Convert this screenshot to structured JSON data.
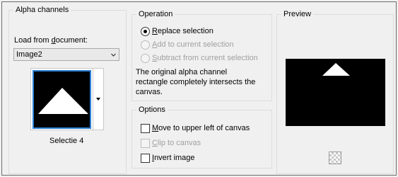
{
  "alpha": {
    "title": "Alpha channels",
    "load_label": "Load from document:",
    "load_label_pre": "Load from ",
    "load_label_u": "d",
    "load_label_post": "ocument:",
    "document_value": "Image2",
    "selection_name": "Selectie 4"
  },
  "operation": {
    "title": "Operation",
    "options": [
      {
        "pre": "",
        "u": "R",
        "post": "eplace selection",
        "checked": true,
        "enabled": true
      },
      {
        "pre": "",
        "u": "A",
        "post": "dd to current selection",
        "checked": false,
        "enabled": false
      },
      {
        "pre": "",
        "u": "S",
        "post": "ubtract from current selection",
        "checked": false,
        "enabled": false
      }
    ],
    "message_line1": "The original alpha channel",
    "message_line2": "rectangle completely intersects the",
    "message_line3": "canvas."
  },
  "options": {
    "title": "Options",
    "items": [
      {
        "pre": "",
        "u": "M",
        "post": "ove to upper left of canvas",
        "checked": false,
        "enabled": true
      },
      {
        "pre": "",
        "u": "C",
        "post": "lip to canvas",
        "checked": false,
        "enabled": false
      },
      {
        "pre": "",
        "u": "I",
        "post": "nvert image",
        "checked": false,
        "enabled": true
      }
    ]
  },
  "preview": {
    "title": "Preview",
    "transparency_icon": "checkerboard-icon"
  },
  "colors": {
    "thumb_border": "#2c7fd6",
    "canvas": "#000000",
    "shape": "#ffffff"
  }
}
